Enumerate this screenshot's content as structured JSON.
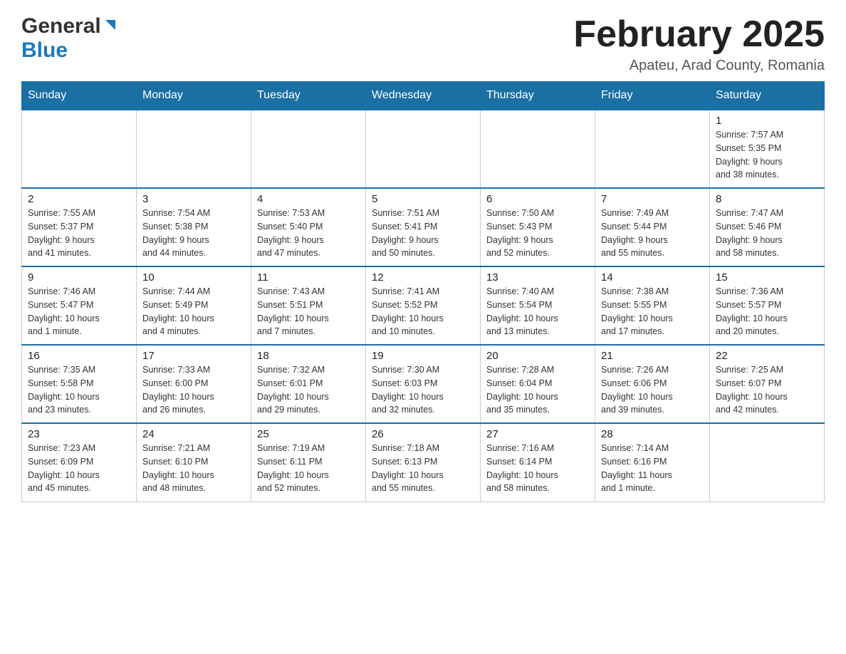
{
  "header": {
    "logo_general": "General",
    "logo_blue": "Blue",
    "month_title": "February 2025",
    "location": "Apateu, Arad County, Romania"
  },
  "days_of_week": [
    "Sunday",
    "Monday",
    "Tuesday",
    "Wednesday",
    "Thursday",
    "Friday",
    "Saturday"
  ],
  "weeks": [
    [
      {
        "day": "",
        "info": ""
      },
      {
        "day": "",
        "info": ""
      },
      {
        "day": "",
        "info": ""
      },
      {
        "day": "",
        "info": ""
      },
      {
        "day": "",
        "info": ""
      },
      {
        "day": "",
        "info": ""
      },
      {
        "day": "1",
        "info": "Sunrise: 7:57 AM\nSunset: 5:35 PM\nDaylight: 9 hours\nand 38 minutes."
      }
    ],
    [
      {
        "day": "2",
        "info": "Sunrise: 7:55 AM\nSunset: 5:37 PM\nDaylight: 9 hours\nand 41 minutes."
      },
      {
        "day": "3",
        "info": "Sunrise: 7:54 AM\nSunset: 5:38 PM\nDaylight: 9 hours\nand 44 minutes."
      },
      {
        "day": "4",
        "info": "Sunrise: 7:53 AM\nSunset: 5:40 PM\nDaylight: 9 hours\nand 47 minutes."
      },
      {
        "day": "5",
        "info": "Sunrise: 7:51 AM\nSunset: 5:41 PM\nDaylight: 9 hours\nand 50 minutes."
      },
      {
        "day": "6",
        "info": "Sunrise: 7:50 AM\nSunset: 5:43 PM\nDaylight: 9 hours\nand 52 minutes."
      },
      {
        "day": "7",
        "info": "Sunrise: 7:49 AM\nSunset: 5:44 PM\nDaylight: 9 hours\nand 55 minutes."
      },
      {
        "day": "8",
        "info": "Sunrise: 7:47 AM\nSunset: 5:46 PM\nDaylight: 9 hours\nand 58 minutes."
      }
    ],
    [
      {
        "day": "9",
        "info": "Sunrise: 7:46 AM\nSunset: 5:47 PM\nDaylight: 10 hours\nand 1 minute."
      },
      {
        "day": "10",
        "info": "Sunrise: 7:44 AM\nSunset: 5:49 PM\nDaylight: 10 hours\nand 4 minutes."
      },
      {
        "day": "11",
        "info": "Sunrise: 7:43 AM\nSunset: 5:51 PM\nDaylight: 10 hours\nand 7 minutes."
      },
      {
        "day": "12",
        "info": "Sunrise: 7:41 AM\nSunset: 5:52 PM\nDaylight: 10 hours\nand 10 minutes."
      },
      {
        "day": "13",
        "info": "Sunrise: 7:40 AM\nSunset: 5:54 PM\nDaylight: 10 hours\nand 13 minutes."
      },
      {
        "day": "14",
        "info": "Sunrise: 7:38 AM\nSunset: 5:55 PM\nDaylight: 10 hours\nand 17 minutes."
      },
      {
        "day": "15",
        "info": "Sunrise: 7:36 AM\nSunset: 5:57 PM\nDaylight: 10 hours\nand 20 minutes."
      }
    ],
    [
      {
        "day": "16",
        "info": "Sunrise: 7:35 AM\nSunset: 5:58 PM\nDaylight: 10 hours\nand 23 minutes."
      },
      {
        "day": "17",
        "info": "Sunrise: 7:33 AM\nSunset: 6:00 PM\nDaylight: 10 hours\nand 26 minutes."
      },
      {
        "day": "18",
        "info": "Sunrise: 7:32 AM\nSunset: 6:01 PM\nDaylight: 10 hours\nand 29 minutes."
      },
      {
        "day": "19",
        "info": "Sunrise: 7:30 AM\nSunset: 6:03 PM\nDaylight: 10 hours\nand 32 minutes."
      },
      {
        "day": "20",
        "info": "Sunrise: 7:28 AM\nSunset: 6:04 PM\nDaylight: 10 hours\nand 35 minutes."
      },
      {
        "day": "21",
        "info": "Sunrise: 7:26 AM\nSunset: 6:06 PM\nDaylight: 10 hours\nand 39 minutes."
      },
      {
        "day": "22",
        "info": "Sunrise: 7:25 AM\nSunset: 6:07 PM\nDaylight: 10 hours\nand 42 minutes."
      }
    ],
    [
      {
        "day": "23",
        "info": "Sunrise: 7:23 AM\nSunset: 6:09 PM\nDaylight: 10 hours\nand 45 minutes."
      },
      {
        "day": "24",
        "info": "Sunrise: 7:21 AM\nSunset: 6:10 PM\nDaylight: 10 hours\nand 48 minutes."
      },
      {
        "day": "25",
        "info": "Sunrise: 7:19 AM\nSunset: 6:11 PM\nDaylight: 10 hours\nand 52 minutes."
      },
      {
        "day": "26",
        "info": "Sunrise: 7:18 AM\nSunset: 6:13 PM\nDaylight: 10 hours\nand 55 minutes."
      },
      {
        "day": "27",
        "info": "Sunrise: 7:16 AM\nSunset: 6:14 PM\nDaylight: 10 hours\nand 58 minutes."
      },
      {
        "day": "28",
        "info": "Sunrise: 7:14 AM\nSunset: 6:16 PM\nDaylight: 11 hours\nand 1 minute."
      },
      {
        "day": "",
        "info": ""
      }
    ]
  ]
}
